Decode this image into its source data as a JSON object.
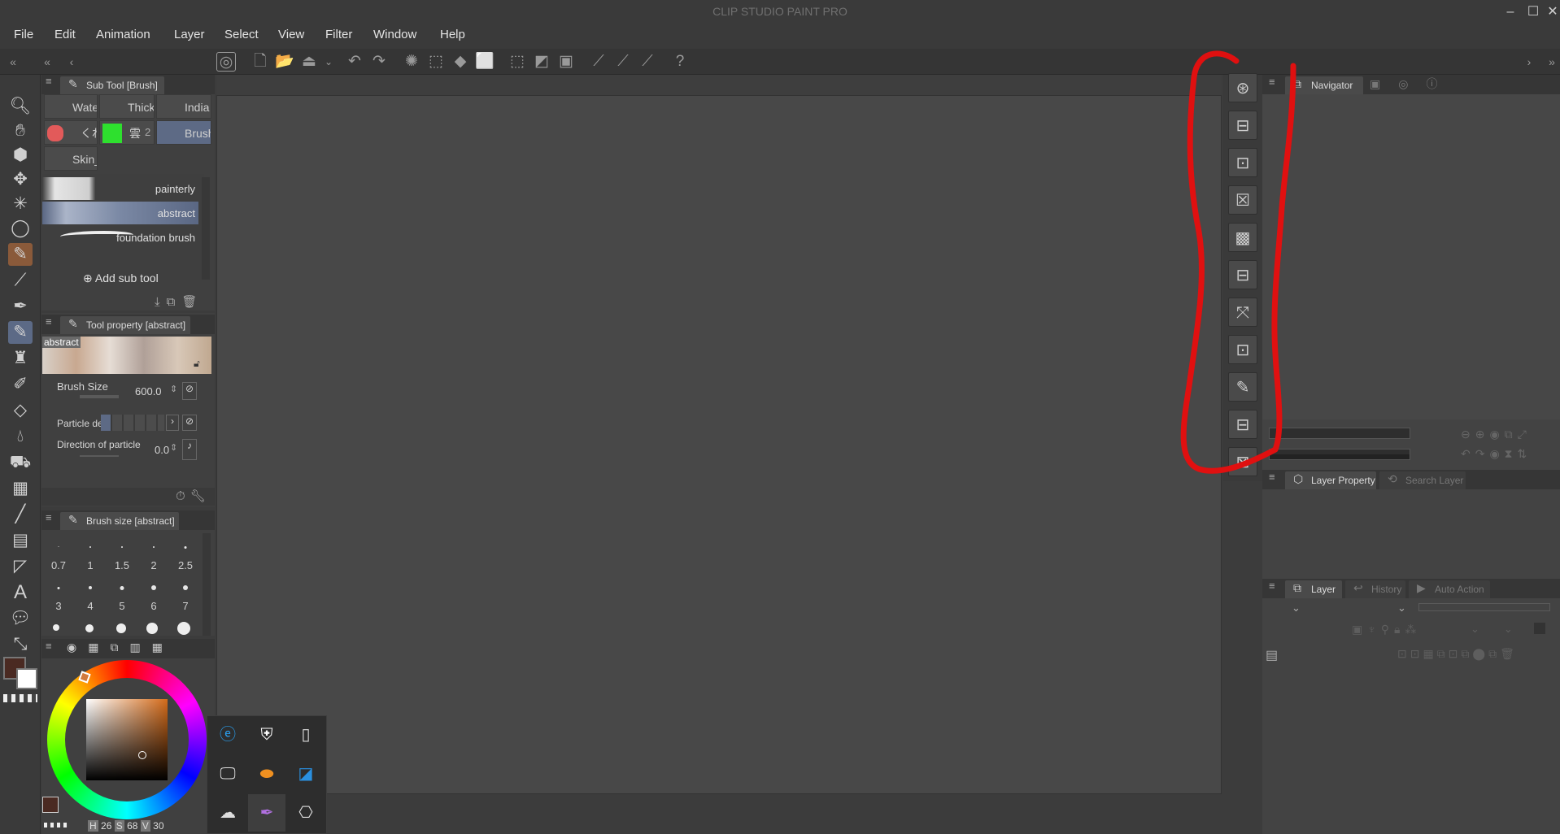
{
  "window": {
    "title": "CLIP STUDIO PAINT PRO",
    "controls": [
      "minimize",
      "maximize",
      "close"
    ]
  },
  "menu": [
    "File",
    "Edit",
    "Animation",
    "Layer",
    "Select",
    "View",
    "Filter",
    "Window",
    "Help"
  ],
  "subtool_panel": {
    "title": "Sub Tool [Brush]",
    "groups": [
      "Wate",
      "Thick",
      "India",
      "くれん",
      "雲",
      "2",
      "Brush",
      "Skin_"
    ],
    "selected_group": "Brush",
    "brushes": [
      {
        "label": "painterly",
        "selected": false
      },
      {
        "label": "abstract",
        "selected": true
      },
      {
        "label": "foundation brush",
        "selected": false
      }
    ],
    "add_label": "Add sub tool"
  },
  "tool_property": {
    "title": "Tool property [abstract]",
    "preview_label": "abstract",
    "brush_size_label": "Brush Size",
    "brush_size_value": "600.0",
    "particle_label": "Particle de",
    "direction_label": "Direction of particle",
    "direction_value": "0.0"
  },
  "brush_size_panel": {
    "title": "Brush size [abstract]",
    "sizes": [
      "0.7",
      "1",
      "1.5",
      "2",
      "2.5",
      "3",
      "4",
      "5",
      "6",
      "7"
    ]
  },
  "color": {
    "main": "#4a2a22",
    "sub": "#ffffff",
    "wheel_selected": "#d27a3c",
    "hsv": {
      "h_label": "H",
      "h": "26",
      "s_label": "S",
      "s": "68",
      "v_label": "V",
      "v": "30"
    }
  },
  "navigator": {
    "title": "Navigator"
  },
  "layer_property": {
    "tabs": [
      "Layer Property",
      "Search Layer"
    ]
  },
  "layer_panel": {
    "tabs": [
      "Layer",
      "History",
      "Auto Action"
    ]
  },
  "dock_buttons": [
    "show-all-icon",
    "panel-icon",
    "panel-icon",
    "close-panel-icon",
    "grid-panel-icon",
    "panel-icon",
    "panel-expand-icon",
    "panel-icon",
    "edit-panel-icon",
    "panel-icon",
    "panel-close-icon"
  ],
  "taskbar_popup": {
    "icons": [
      "edge-icon",
      "security-icon",
      "usb-icon",
      "display-icon",
      "orange-app-icon",
      "blue-app-icon",
      "cloud-icon",
      "pen-icon",
      "camera-icon"
    ]
  },
  "annotation": {
    "color": "#e01010"
  }
}
